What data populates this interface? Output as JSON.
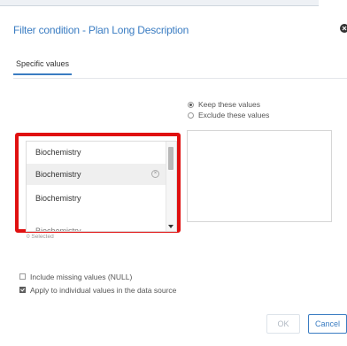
{
  "dialog": {
    "title": "Filter condition - Plan Long Description",
    "close_icon": "close-icon"
  },
  "tabs": [
    {
      "label": "Specific values",
      "active": true
    }
  ],
  "mode_options": {
    "keep_label": "Keep these values",
    "exclude_label": "Exclude these values",
    "selected": "keep"
  },
  "values_list": {
    "items": [
      {
        "label": "Biochemistry"
      },
      {
        "label": "Biochemistry"
      },
      {
        "label": "Biochemistry"
      },
      {
        "label": "Biochemistry"
      }
    ],
    "selected_count_text": "0 Selected"
  },
  "options": {
    "include_missing_label": "Include missing values (NULL)",
    "include_missing_checked": false,
    "apply_individual_label": "Apply to individual values in the data source",
    "apply_individual_checked": true
  },
  "footer": {
    "ok_label": "OK",
    "cancel_label": "Cancel"
  },
  "colors": {
    "accent": "#3a7cc2",
    "highlight_border": "#e01010"
  }
}
